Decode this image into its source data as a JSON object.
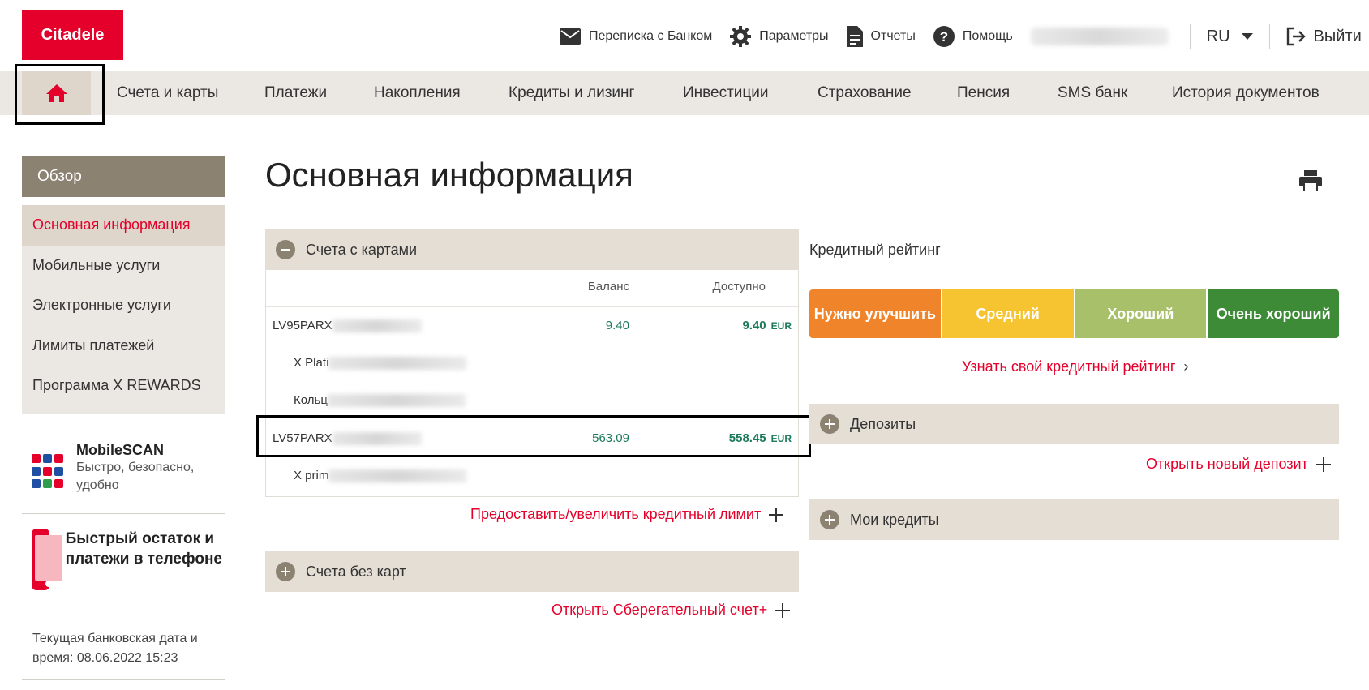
{
  "brand": {
    "logo_text": "Citadele",
    "accent": "#e4002b"
  },
  "header": {
    "links": [
      {
        "label": "Переписка с Банком",
        "icon": "envelope-icon"
      },
      {
        "label": "Параметры",
        "icon": "gear-icon"
      },
      {
        "label": "Отчеты",
        "icon": "document-icon"
      },
      {
        "label": "Помощь",
        "icon": "help-icon"
      }
    ],
    "language": "RU",
    "logout_label": "Выйти"
  },
  "nav": {
    "items": [
      "Счета и карты",
      "Платежи",
      "Накопления",
      "Кредиты и лизинг",
      "Инвестиции",
      "Страхование",
      "Пенсия",
      "SMS банк",
      "История документов"
    ]
  },
  "sidebar": {
    "heading": "Обзор",
    "items": [
      "Основная информация",
      "Мобильные услуги",
      "Электронные услуги",
      "Лимиты платежей",
      "Программа X REWARDS"
    ],
    "promo_mobilescan": {
      "title": "MobileSCAN",
      "subtitle": "Быстро, безопасно, удобно"
    },
    "promo_balance": {
      "title": "Быстрый остаток и платежи в телефоне"
    },
    "bank_date": "Текущая банковская дата и время: 08.06.2022 15:23"
  },
  "main": {
    "title": "Основная информация",
    "accounts_with_cards": {
      "header": "Счета с картами",
      "col_balance": "Баланс",
      "col_available": "Доступно",
      "rows": [
        {
          "account": "LV95PARX",
          "balance": "9.40",
          "available": "9.40",
          "currency": "EUR",
          "sub": [
            "X Plati",
            "Кольц"
          ]
        },
        {
          "account": "LV57PARX",
          "balance": "563.09",
          "available": "558.45",
          "currency": "EUR",
          "sub": [
            "X prim"
          ]
        }
      ],
      "credit_limit_link": "Предоставить/увеличить кредитный лимит"
    },
    "accounts_without_cards": {
      "header": "Счета без карт",
      "open_savings_link": "Открыть Сберегательный счет+"
    }
  },
  "credit_rating": {
    "title": "Кредитный рейтинг",
    "levels": [
      "Нужно улучшить",
      "Средний",
      "Хороший",
      "Очень хороший"
    ],
    "colors": [
      "#f0842b",
      "#f6c431",
      "#a8c06a",
      "#3d8b37"
    ],
    "link": "Узнать свой кредитный рейтинг"
  },
  "deposits": {
    "header": "Депозиты",
    "open_link": "Открыть новый депозит"
  },
  "loans": {
    "header": "Мои кредиты"
  }
}
